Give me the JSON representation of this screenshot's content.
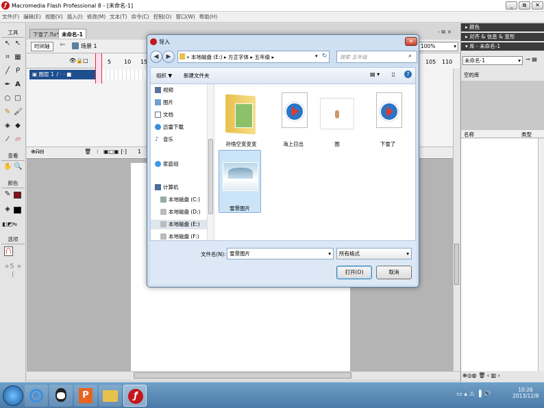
{
  "window": {
    "title": "Macromedia Flash Professional 8 - [未命名-1]",
    "buttons": [
      "_",
      "⧉",
      "✕"
    ]
  },
  "menu": [
    "文件(F)",
    "编辑(E)",
    "视图(V)",
    "插入(I)",
    "修改(M)",
    "文本(T)",
    "命令(C)",
    "控制(O)",
    "窗口(W)",
    "帮助(H)"
  ],
  "tools": {
    "header": "工具",
    "view_label": "查看",
    "colors_label": "颜色",
    "options_label": "选项"
  },
  "doc_tabs": [
    "下雪了.fla*",
    "未命名-1"
  ],
  "editbar": {
    "timeline_btn": "时间轴",
    "scene": "场景 1",
    "zoom": "100%"
  },
  "timeline": {
    "layer": "图层 1",
    "frames_left": [
      "5",
      "10",
      "15"
    ],
    "frames_right": [
      "105",
      "110"
    ],
    "frame_counter": "1"
  },
  "right_panel": {
    "colors": "颜色",
    "align": "对齐 & 信息 & 变形",
    "library": "库 - 未命名-1",
    "library_select": "未命名-1",
    "empty_lib": "空的库",
    "col_name": "名称",
    "col_type": "类型"
  },
  "dialog": {
    "title": "导入",
    "breadcrumb": [
      "«",
      "本地磁盘 (E:)",
      "方正字体",
      "五年级"
    ],
    "search_placeholder": "搜索 五年级",
    "organize": "组织 ▼",
    "new_folder": "新建文件夹",
    "nav_items": [
      {
        "label": "视频",
        "icon": "video-icon"
      },
      {
        "label": "图片",
        "icon": "pictures-icon"
      },
      {
        "label": "文档",
        "icon": "documents-icon"
      },
      {
        "label": "迅雷下载",
        "icon": "download-icon"
      },
      {
        "label": "音乐",
        "icon": "music-icon"
      },
      {
        "label": "家庭组",
        "icon": "homegroup-icon"
      },
      {
        "label": "计算机",
        "icon": "computer-icon"
      },
      {
        "label": "本地磁盘 (C:)",
        "icon": "drive-icon"
      },
      {
        "label": "本地磁盘 (D:)",
        "icon": "drive-icon"
      },
      {
        "label": "本地磁盘 (E:)",
        "icon": "drive-icon"
      },
      {
        "label": "本地磁盘 (F:)",
        "icon": "drive-icon"
      }
    ],
    "files": [
      {
        "label": "孙悟空变变变",
        "kind": "folder"
      },
      {
        "label": "海上日出",
        "kind": "media"
      },
      {
        "label": "图",
        "kind": "image"
      },
      {
        "label": "下雪了",
        "kind": "media"
      },
      {
        "label": "雪景图片",
        "kind": "photo"
      }
    ],
    "filename_label": "文件名(N):",
    "filename_value": "雪景图片",
    "filetype_value": "所有格式",
    "open_btn": "打开(O)",
    "cancel_btn": "取消"
  },
  "taskbar": {
    "time": "10:26",
    "date": "2013/12/8"
  },
  "colors": {
    "flash_red": "#c4161c",
    "dialog_frame": "#cfe0f2",
    "selected": "#cce4f7"
  }
}
